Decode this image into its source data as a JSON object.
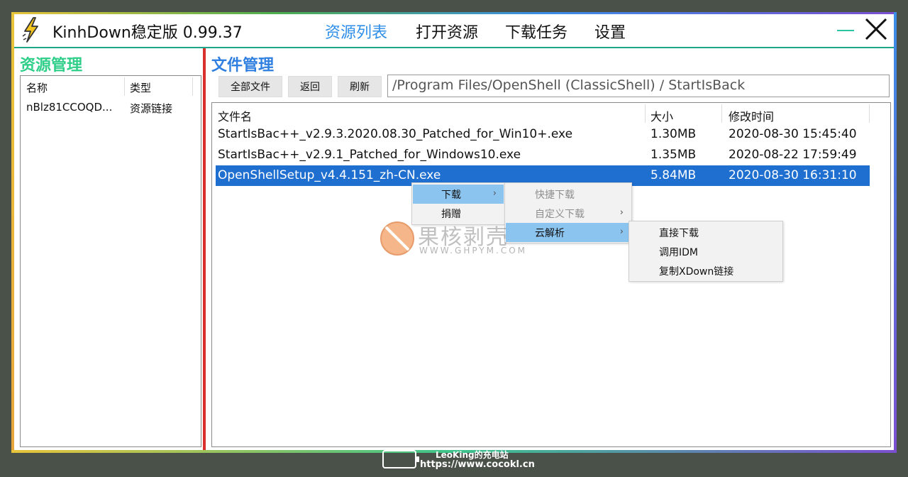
{
  "app": {
    "title": "KinhDown稳定版 0.99.37",
    "nav": [
      "资源列表",
      "打开资源",
      "下载任务",
      "设置"
    ],
    "active_nav": "资源列表",
    "minimize_label": "—",
    "close_label": "✕"
  },
  "left_panel": {
    "title": "资源管理",
    "columns": [
      "名称",
      "类型"
    ],
    "rows": [
      {
        "name": "nBlz81CCOQD...",
        "type": "资源链接"
      }
    ]
  },
  "right_panel": {
    "title": "文件管理",
    "buttons": {
      "all_files": "全部文件",
      "back": "返回",
      "refresh": "刷新"
    },
    "path": "/Program Files/OpenShell (ClassicShell)  / StartIsBack",
    "columns": [
      "文件名",
      "大小",
      "修改时间"
    ],
    "files": [
      {
        "name": "StartIsBac++_v2.9.3.2020.08.30_Patched_for_Win10+.exe",
        "size": "1.30MB",
        "modified": "2020-08-30 15:45:40"
      },
      {
        "name": "StartIsBac++_v2.9.1_Patched_for_Windows10.exe",
        "size": "1.35MB",
        "modified": "2020-08-22 17:59:49"
      },
      {
        "name": "OpenShellSetup_v4.4.151_zh-CN.exe",
        "size": "5.84MB",
        "modified": "2020-08-30 16:31:10"
      }
    ],
    "selected_file": "OpenShellSetup_v4.4.151_zh-CN.exe"
  },
  "context_menu": {
    "main": [
      {
        "label": "下载",
        "submenu": true,
        "highlighted": true
      },
      {
        "label": "捐赠",
        "submenu": false
      }
    ],
    "download": [
      {
        "label": "快捷下载",
        "disabled": true
      },
      {
        "label": "自定义下载",
        "disabled": true,
        "submenu": true
      },
      {
        "label": "云解析",
        "highlighted": true,
        "submenu": true
      }
    ],
    "cloud": [
      {
        "label": "直接下载"
      },
      {
        "label": "调用IDM"
      },
      {
        "label": "复制XDown链接"
      }
    ],
    "submenu_arrow": "›"
  },
  "watermark": {
    "text": "果核剥壳",
    "url": "WWW.GHPYM.COM"
  },
  "overlay": {
    "name": "LeoKing的充电站",
    "url": "https://www.cocokl.cn"
  },
  "colors": {
    "accent_blue": "#2f8fe8",
    "left_title": "#2fcf8a",
    "right_title": "#2f7fe0",
    "selection": "#1e6fd0",
    "divider": "#d9302c",
    "menu_highlight": "#8cc4f0"
  }
}
